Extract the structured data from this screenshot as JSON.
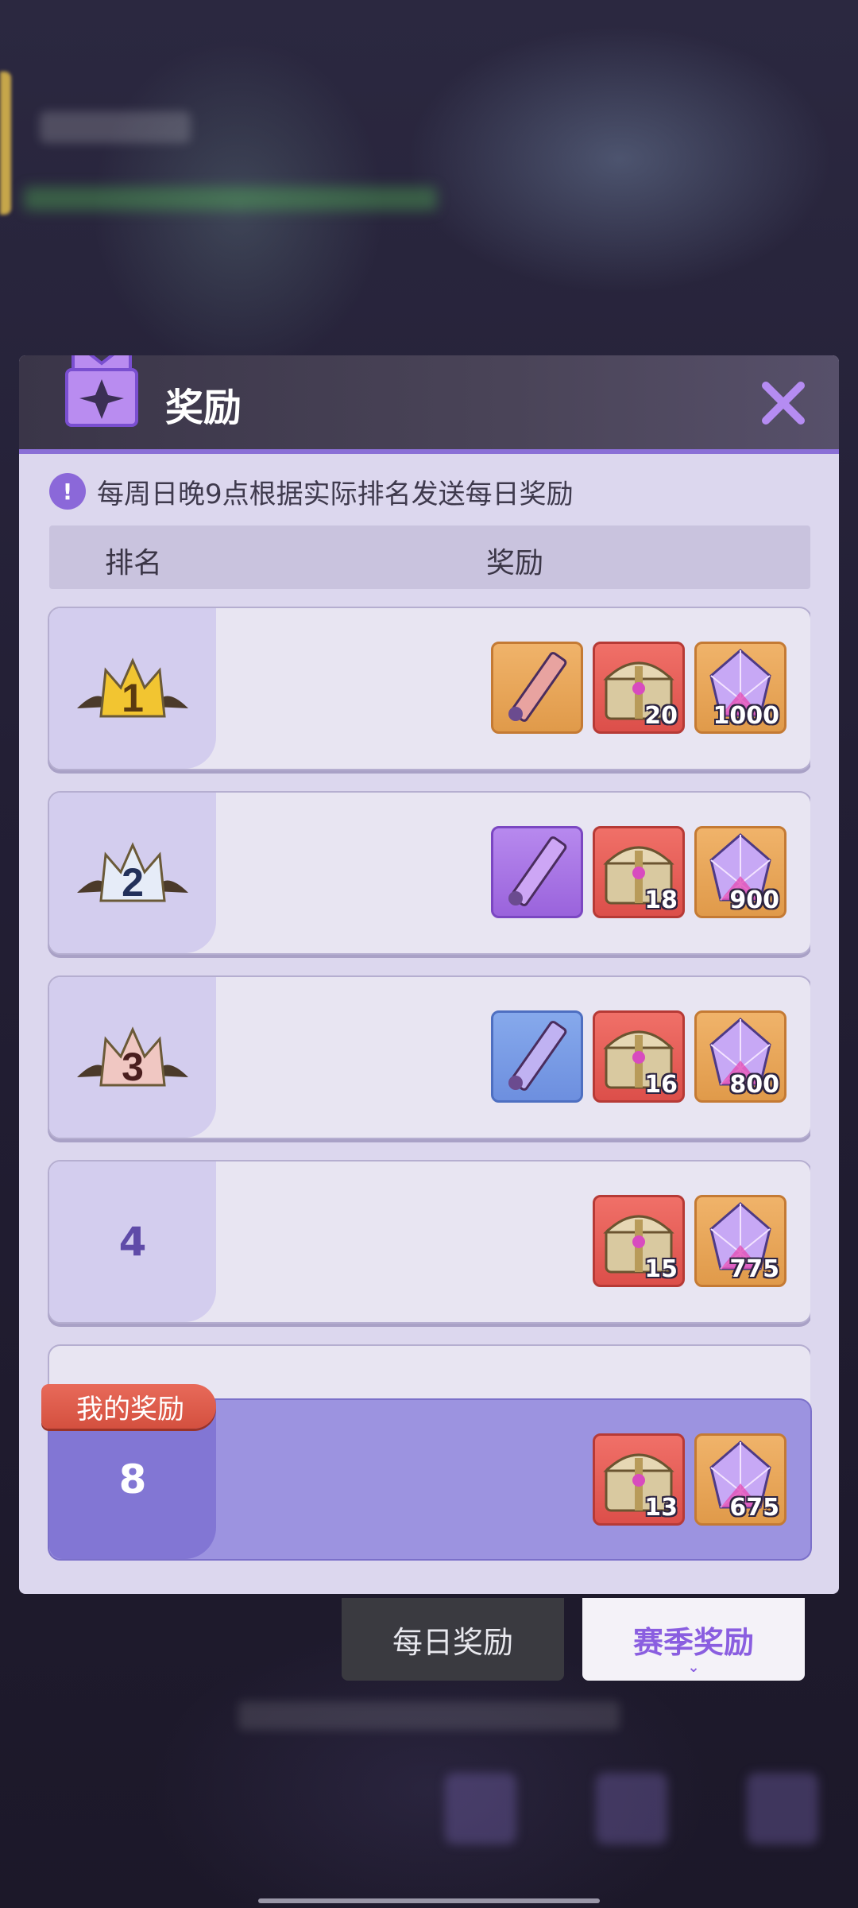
{
  "panel": {
    "title": "奖励",
    "notice": "每周日晚9点根据实际排名发送每日奖励",
    "columns": {
      "rank": "排名",
      "reward": "奖励"
    }
  },
  "rows": [
    {
      "rank": "1",
      "crown": "gold-crown",
      "items": [
        {
          "icon": "scroll-orange",
          "bg": "orange",
          "qty": ""
        },
        {
          "icon": "treasure-chest",
          "bg": "red",
          "qty": "20"
        },
        {
          "icon": "crystal",
          "bg": "orange",
          "qty": "1000"
        }
      ]
    },
    {
      "rank": "2",
      "crown": "silver-crown",
      "items": [
        {
          "icon": "scroll-purple",
          "bg": "purple",
          "qty": ""
        },
        {
          "icon": "treasure-chest",
          "bg": "red",
          "qty": "18"
        },
        {
          "icon": "crystal",
          "bg": "orange",
          "qty": "900"
        }
      ]
    },
    {
      "rank": "3",
      "crown": "bronze-crown",
      "items": [
        {
          "icon": "scroll-blue",
          "bg": "blue",
          "qty": ""
        },
        {
          "icon": "treasure-chest",
          "bg": "red",
          "qty": "16"
        },
        {
          "icon": "crystal",
          "bg": "orange",
          "qty": "800"
        }
      ]
    },
    {
      "rank": "4",
      "crown": "",
      "items": [
        {
          "icon": "treasure-chest",
          "bg": "red",
          "qty": "15"
        },
        {
          "icon": "crystal",
          "bg": "orange",
          "qty": "775"
        }
      ]
    }
  ],
  "my_reward": {
    "tag": "我的奖励",
    "rank": "8",
    "items": [
      {
        "icon": "treasure-chest",
        "bg": "red",
        "qty": "13"
      },
      {
        "icon": "crystal",
        "bg": "orange",
        "qty": "675"
      }
    ]
  },
  "tabs": {
    "daily": "每日奖励",
    "season": "赛季奖励",
    "active": "season"
  },
  "colors": {
    "accent": "#8a5ee0",
    "panel_bg": "#dcd7ee",
    "my_reward_bg": "#9c93e0",
    "tag_red": "#d4503f"
  }
}
